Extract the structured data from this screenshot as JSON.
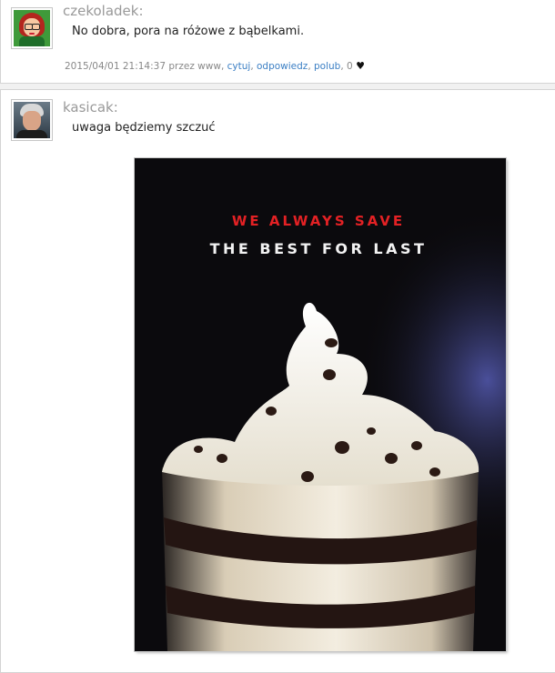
{
  "posts": [
    {
      "username": "czekoladek:",
      "message": "No dobra, pora na różowe z bąbelkami.",
      "meta": {
        "datetime": "2015/04/01 21:14:37",
        "by_label": "przez",
        "author": "www",
        "reply_quote": "cytuj",
        "reply": "odpowiedz",
        "like": "polub",
        "likes_count": "0"
      }
    },
    {
      "username": "kasicak:",
      "message": "uwaga będziemy szczuć",
      "image": {
        "line1": "WE ALWAYS SAVE",
        "line2": "THE BEST FOR LAST"
      }
    }
  ],
  "colors": {
    "link": "#3b7fc4",
    "poster_red": "#e32124",
    "poster_bg": "#0b0a0d"
  },
  "icons": [
    "heart-icon"
  ]
}
